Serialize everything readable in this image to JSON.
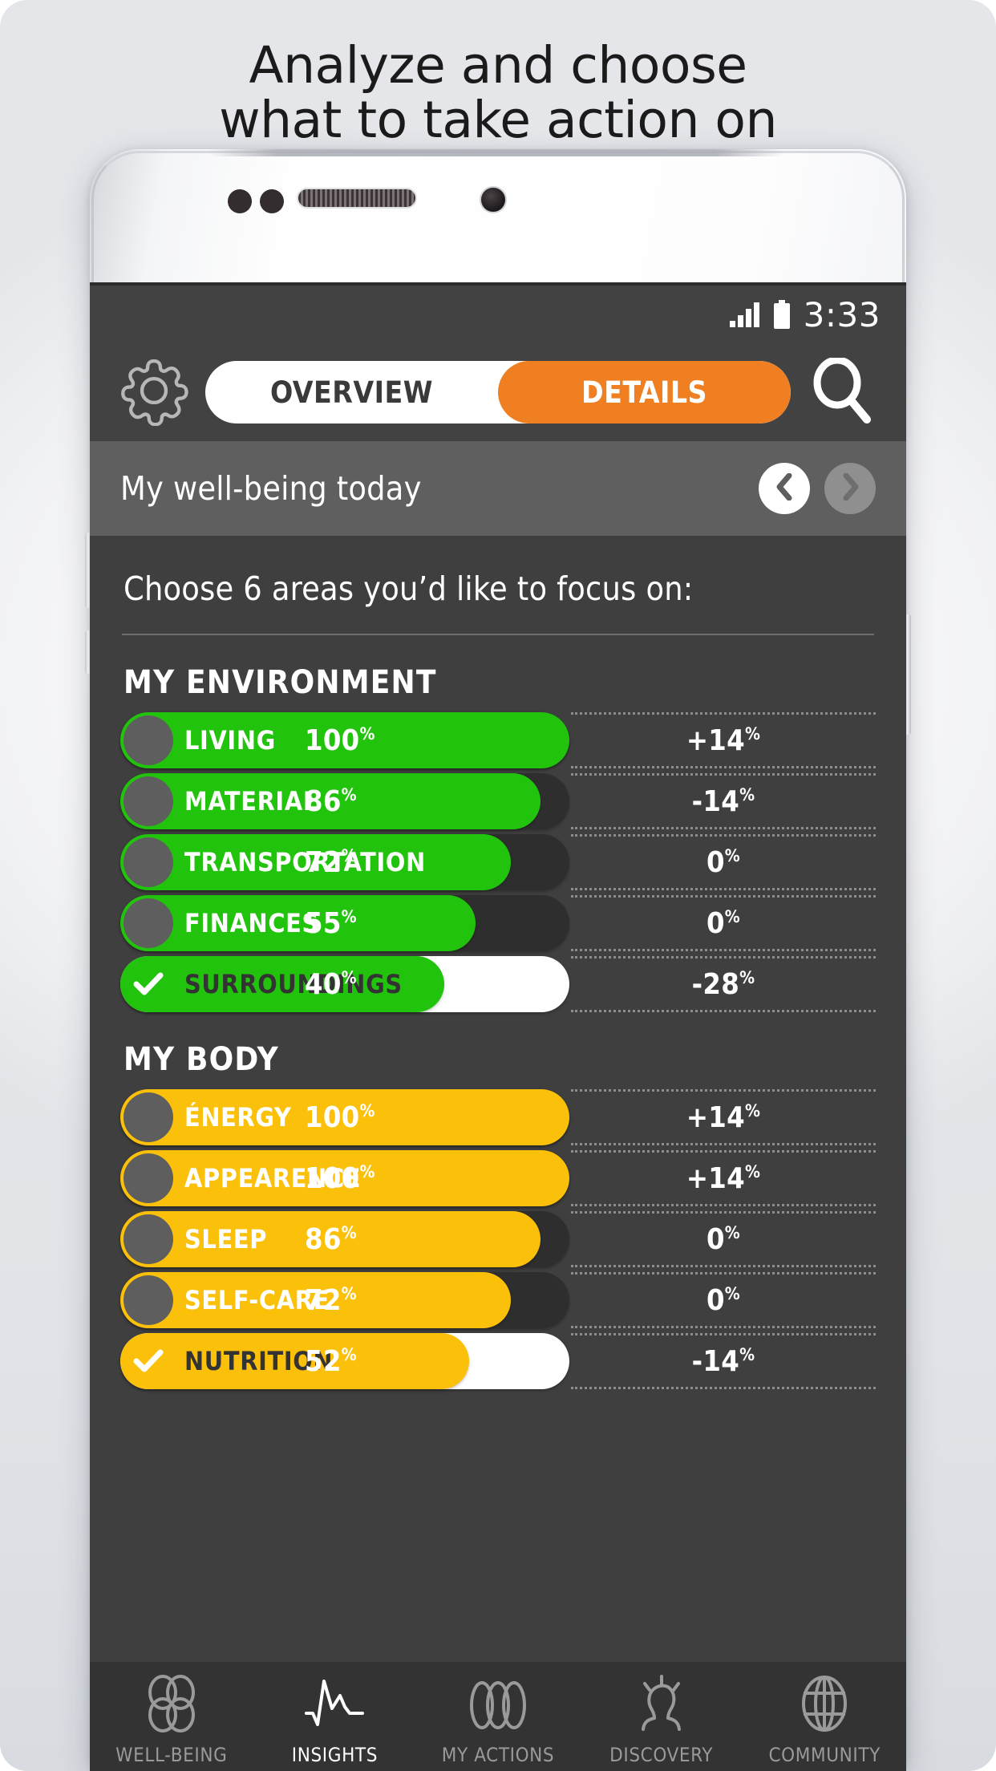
{
  "promo": {
    "headline_line1": "Analyze and choose",
    "headline_line2": "what to take action on"
  },
  "status_bar": {
    "time": "3:33",
    "signal_icon": "signal-bars-icon",
    "battery_icon": "battery-full-icon"
  },
  "toolbar": {
    "settings_icon": "gear-icon",
    "search_icon": "search-icon",
    "tabs": [
      {
        "label": "OVERVIEW",
        "active": false
      },
      {
        "label": "DETAILS",
        "active": true
      }
    ]
  },
  "subheader": {
    "title": "My well-being today",
    "prev_icon": "chevron-left-icon",
    "next_icon": "chevron-right-icon"
  },
  "content": {
    "prompt": "Choose 6 areas you’d like to focus on:"
  },
  "colors": {
    "accent_orange": "#ef7f20",
    "green": "#22c30c",
    "yellow": "#fbc10a",
    "screen_bg": "#3f3f3f",
    "toolbar_bg": "#424242",
    "subheader_bg": "#5f5f5f",
    "track_bg": "#2e2e2e"
  },
  "sections": [
    {
      "title": "MY ENVIRONMENT",
      "accent": "#22c30c",
      "rows": [
        {
          "label": "LIVING",
          "value": 100,
          "value_text": "100",
          "delta": "+14",
          "selected": false,
          "bar_pct": 100
        },
        {
          "label": "MATERIAL",
          "value": 86,
          "value_text": "86",
          "delta": "-14",
          "selected": false,
          "bar_pct": 86
        },
        {
          "label": "TRANSPORTATION",
          "value": 72,
          "value_text": "72",
          "delta": "0",
          "selected": false,
          "bar_pct": 72
        },
        {
          "label": "FINANCES",
          "value": 55,
          "value_text": "55",
          "delta": "0",
          "selected": false,
          "bar_pct": 55
        },
        {
          "label": "SURROUNDINGS",
          "value": 40,
          "value_text": "40",
          "delta": "-28",
          "selected": true,
          "bar_pct": 40
        }
      ]
    },
    {
      "title": "MY BODY",
      "accent": "#fbc10a",
      "rows": [
        {
          "label": "ÉNERGY",
          "value": 100,
          "value_text": "100",
          "delta": "+14",
          "selected": false,
          "bar_pct": 100
        },
        {
          "label": "APPEARENCE",
          "value": 100,
          "value_text": "100",
          "delta": "+14",
          "selected": false,
          "bar_pct": 100
        },
        {
          "label": "SLEEP",
          "value": 86,
          "value_text": "86",
          "delta": "0",
          "selected": false,
          "bar_pct": 86
        },
        {
          "label": "SELF-CARE",
          "value": 72,
          "value_text": "72",
          "delta": "0",
          "selected": false,
          "bar_pct": 72
        },
        {
          "label": "NUTRITION",
          "value": 52,
          "value_text": "52",
          "delta": "-14",
          "selected": true,
          "bar_pct": 52
        }
      ]
    }
  ],
  "bottom_nav": [
    {
      "label": "WELL-BEING",
      "icon": "flower-icon",
      "active": false
    },
    {
      "label": "INSIGHTS",
      "icon": "waveform-icon",
      "active": true
    },
    {
      "label": "MY ACTIONS",
      "icon": "loops-icon",
      "active": false
    },
    {
      "label": "DISCOVERY",
      "icon": "lightbulb-person-icon",
      "active": false
    },
    {
      "label": "COMMUNITY",
      "icon": "globe-icon",
      "active": false
    }
  ]
}
